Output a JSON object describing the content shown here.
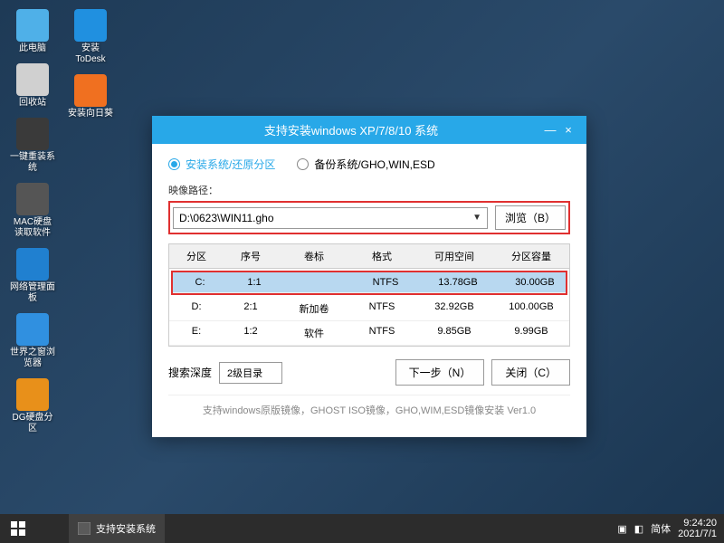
{
  "desktop_icons_col1": [
    {
      "label": "此电脑",
      "color": "#4fb0e8"
    },
    {
      "label": "回收站",
      "color": "#d0d0d0"
    },
    {
      "label": "一键重装系统",
      "color": "#3a3a3a"
    },
    {
      "label": "MAC硬盘读取软件",
      "color": "#555"
    },
    {
      "label": "网络管理面板",
      "color": "#2080d0"
    },
    {
      "label": "世界之窗浏览器",
      "color": "#3090e0"
    },
    {
      "label": "DG硬盘分区",
      "color": "#e8901a"
    }
  ],
  "desktop_icons_col2": [
    {
      "label": "安装ToDesk",
      "color": "#2090e0"
    },
    {
      "label": "安装向日葵",
      "color": "#f07020"
    }
  ],
  "window": {
    "title": "支持安装windows XP/7/8/10 系统",
    "minimize": "—",
    "close": "×",
    "radio1": "安装系统/还原分区",
    "radio2": "备份系统/GHO,WIN,ESD",
    "path_label": "映像路径：",
    "path_value": "D:\\0623\\WIN11.gho",
    "browse": "浏览（B）",
    "columns": [
      "分区",
      "序号",
      "卷标",
      "格式",
      "可用空间",
      "分区容量"
    ],
    "rows": [
      {
        "cells": [
          "C:",
          "1:1",
          "",
          "NTFS",
          "13.78GB",
          "30.00GB"
        ],
        "selected": true,
        "highlighted": true
      },
      {
        "cells": [
          "D:",
          "2:1",
          "新加卷",
          "NTFS",
          "32.92GB",
          "100.00GB"
        ],
        "selected": false,
        "highlighted": false
      },
      {
        "cells": [
          "E:",
          "1:2",
          "软件",
          "NTFS",
          "9.85GB",
          "9.99GB"
        ],
        "selected": false,
        "highlighted": false
      }
    ],
    "depth_label": "搜索深度",
    "depth_value": "2级目录",
    "next_btn": "下一步（N）",
    "close_btn": "关闭（C）",
    "footer": "支持windows原版镜像，GHOST ISO镜像，GHO,WIM,ESD镜像安装 Ver1.0"
  },
  "taskbar": {
    "task1": "支持安装系统",
    "ime": "简体",
    "time": "9:24:20",
    "date": "2021/7/1"
  }
}
